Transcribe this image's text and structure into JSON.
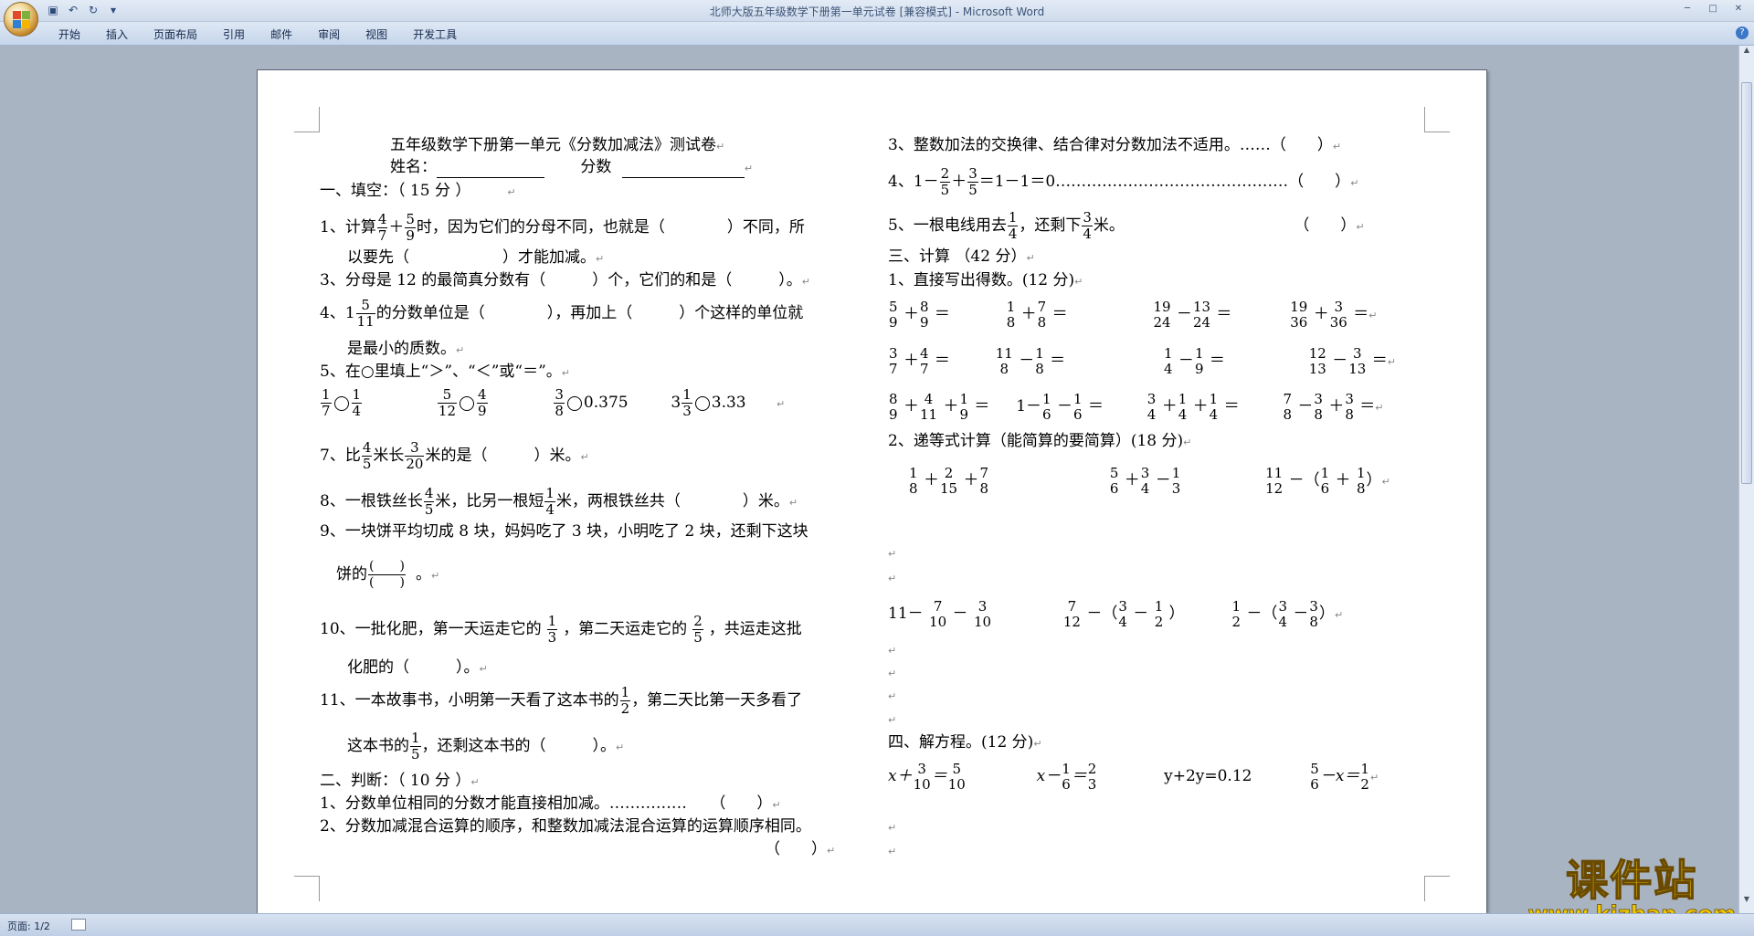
{
  "window": {
    "title": "北师大版五年级数学下册第一单元试卷 [兼容模式] - Microsoft Word",
    "ribbon_tabs": [
      "开始",
      "插入",
      "页面布局",
      "引用",
      "邮件",
      "审阅",
      "视图",
      "开发工具"
    ],
    "status_page": "页面: 1/2"
  },
  "doc": {
    "title": "五年级数学下册第一单元《分数加减法》测试卷",
    "name_label": "姓名：",
    "score_label": "分数",
    "s1_heading": "一、填空：（ 15 分 ）",
    "q1_a": "1、计算",
    "q1_f1": {
      "n": "4",
      "d": "7"
    },
    "q1_f2": {
      "n": "5",
      "d": "9"
    },
    "q1_b": "时，因为它们的分母不同，也就是（　　　　）不同，所",
    "q1_c": "以要先（　　　　　　）才能加减。",
    "q3": "3、分母是 12 的最简真分数有（　　　）个，它们的和是（　　　）。",
    "q4_a": "4、1",
    "q4_f": {
      "n": "5",
      "d": "11"
    },
    "q4_b": "的分数单位是（　　　　），再加上（　　　）个这样的单位就",
    "q4_c": "是最小的质数。",
    "q5": "5、在○里填上“＞”、“＜”或“＝”。",
    "cmp1_a": {
      "n": "1",
      "d": "7"
    },
    "cmp1_b": {
      "n": "1",
      "d": "4"
    },
    "cmp2_a": {
      "n": "5",
      "d": "12"
    },
    "cmp2_b": {
      "n": "4",
      "d": "9"
    },
    "cmp3_a": {
      "n": "3",
      "d": "8"
    },
    "cmp3_b": "0.375",
    "cmp4_w": "3",
    "cmp4_a": {
      "n": "1",
      "d": "3"
    },
    "cmp4_b": "3.33",
    "q7_a": "7、比",
    "q7_f1": {
      "n": "4",
      "d": "5"
    },
    "q7_b": "米长",
    "q7_f2": {
      "n": "3",
      "d": "20"
    },
    "q7_c": "米的是（　　　）米。",
    "q8_a": "8、一根铁丝长",
    "q8_f1": {
      "n": "4",
      "d": "5"
    },
    "q8_b": "米，比另一根短",
    "q8_f2": {
      "n": "1",
      "d": "4"
    },
    "q8_c": "米，两根铁丝共（　　　　）米。",
    "q9_a": "9、一块饼平均切成 8 块，妈妈吃了 3 块，小明吃了 2 块，还剩下这块",
    "q9_b": "饼的",
    "q9_f": {
      "n": "(　　)",
      "d": "(　　)"
    },
    "q9_c": "。",
    "q10_a": "10、一批化肥，第一天运走它的",
    "q10_f1": {
      "n": "1",
      "d": "3"
    },
    "q10_b": "，第二天运走它的",
    "q10_f2": {
      "n": "2",
      "d": "5"
    },
    "q10_c": "，共运走这批",
    "q10_d": "化肥的（　　　）。",
    "q11_a": "11、一本故事书，小明第一天看了这本书的",
    "q11_f1": {
      "n": "1",
      "d": "2"
    },
    "q11_b": "，第二天比第一天多看了",
    "q11_c": "这本书的",
    "q11_f2": {
      "n": "1",
      "d": "5"
    },
    "q11_d": "，还剩这本书的（　　　）。",
    "s2_heading": "二、判断：（ 10 分 ）",
    "j1": "1、分数单位相同的分数才能直接相加减。……………　　（　　）",
    "j2": "2、分数加减混合运算的顺序，和整数加减法混合运算的运算顺序相同。",
    "j2_paren": "（　　）",
    "j3": "3、整数加法的交换律、结合律对分数加法不适用。……（　　）",
    "j4_a": "4、1－",
    "j4_f1": {
      "n": "2",
      "d": "5"
    },
    "j4_plus": "＋",
    "j4_f2": {
      "n": "3",
      "d": "5"
    },
    "j4_b": "＝1－1＝0………………………………………（　　）",
    "j5_a": "5、一根电线用去",
    "j5_f1": {
      "n": "1",
      "d": "4"
    },
    "j5_b": "，还剩下",
    "j5_f2": {
      "n": "3",
      "d": "4"
    },
    "j5_c": "米。",
    "j5_paren": "（　　）",
    "s3_heading": "三、计算 （42 分）",
    "c1_heading": "1、直接写出得数。(12 分)",
    "c2_heading": "2、递等式计算（能简算的要简算）(18 分)",
    "s4_heading": "四、解方程。(12 分)",
    "eq3": "y+2y=0.12",
    "para_mark": "↵",
    "op_plus": "＋",
    "op_minus": "－",
    "op_eq": "＝"
  },
  "watermark": {
    "brand": "课件站",
    "url": "www.kjzhan.com"
  }
}
